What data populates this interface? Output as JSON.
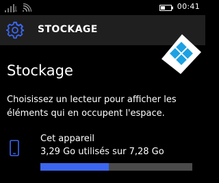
{
  "status_bar": {
    "time": "00:41",
    "icons": [
      "signal-icon",
      "wifi-icon",
      "battery-icon"
    ]
  },
  "header": {
    "icon": "gear-icon",
    "title": "STOCKAGE"
  },
  "page": {
    "title": "Stockage",
    "description": "Choisissez un lecteur pour afficher les éléments qui en occupent l'espace."
  },
  "drives": [
    {
      "icon": "phone-icon",
      "name": "Cet appareil",
      "usage_text": "3,29 Go utilisés sur 7,28 Go",
      "used_fraction": 0.452
    }
  ],
  "colors": {
    "accent": "#3c66f0",
    "header_bg": "#1f1f1f",
    "bar_track": "#4a4a4a",
    "background": "#000000"
  }
}
